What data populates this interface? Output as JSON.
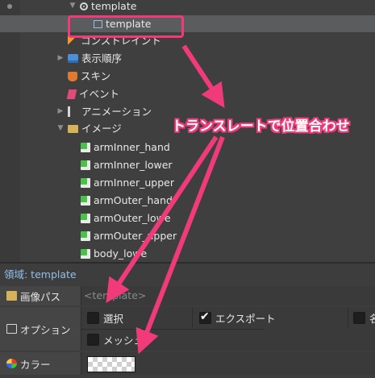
{
  "tree": {
    "items": [
      {
        "label": "template",
        "icon": "bone-root-icon",
        "expanded": true
      },
      {
        "label": "template",
        "icon": "region-icon",
        "selected": true
      },
      {
        "label": "コンストレイント",
        "icon": "constraint-icon"
      },
      {
        "label": "表示順序",
        "icon": "draw-order-icon"
      },
      {
        "label": "スキン",
        "icon": "skin-icon"
      },
      {
        "label": "イベント",
        "icon": "event-icon"
      },
      {
        "label": "アニメーション",
        "icon": "animation-icon"
      },
      {
        "label": "イメージ",
        "icon": "folder-icon",
        "expanded": true
      },
      {
        "label": "armInner_hand",
        "icon": "image-icon"
      },
      {
        "label": "armInner_lower",
        "icon": "image-icon"
      },
      {
        "label": "armInner_upper",
        "icon": "image-icon"
      },
      {
        "label": "armOuter_hand",
        "icon": "image-icon"
      },
      {
        "label": "armOuter_lowe",
        "icon": "image-icon"
      },
      {
        "label": "armOuter_upper",
        "icon": "image-icon"
      },
      {
        "label": "body_lowe",
        "icon": "image-icon"
      }
    ]
  },
  "annotation": {
    "text": "トランスレートで位置合わせ",
    "color": "#f03a7a"
  },
  "properties": {
    "title": "領域: template",
    "image_path_label": "画像パス",
    "image_path_placeholder": "<template>",
    "options_label": "オプション",
    "options": [
      {
        "label": "選択",
        "checked": false
      },
      {
        "label": "エクスポート",
        "checked": true
      },
      {
        "label": "名",
        "checked": false
      },
      {
        "label": "メッシュ",
        "checked": false
      }
    ],
    "color_label": "カラー"
  },
  "colors": {
    "accent": "#f03a7a",
    "region_title": "#8fc0e8",
    "selection": "#5a5c5e"
  }
}
